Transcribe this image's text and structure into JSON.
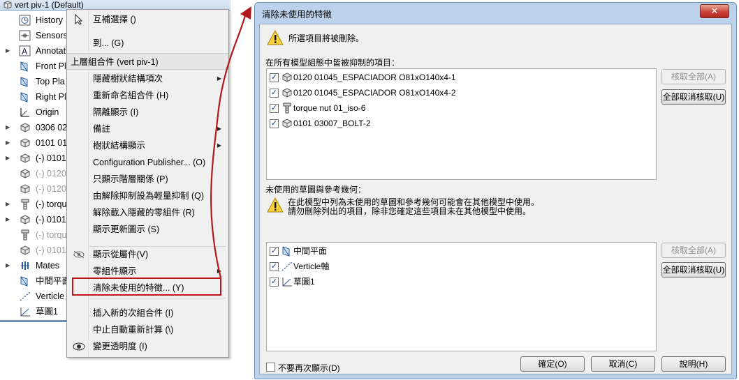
{
  "tree": {
    "title": "vert piv-1  (Default)",
    "items": [
      {
        "label": "History",
        "icon": "history-icon",
        "expand": ""
      },
      {
        "label": "Sensors",
        "icon": "sensor-icon",
        "expand": ""
      },
      {
        "label": "Annotat",
        "icon": "annotation-icon",
        "expand": "▶"
      },
      {
        "label": "Front Pl",
        "icon": "plane-icon",
        "expand": ""
      },
      {
        "label": "Top Pla",
        "icon": "plane-icon",
        "expand": ""
      },
      {
        "label": "Right Pl",
        "icon": "plane-icon",
        "expand": ""
      },
      {
        "label": "Origin",
        "icon": "origin-icon",
        "expand": ""
      },
      {
        "label": "0306 02",
        "icon": "part-icon",
        "expand": "▶"
      },
      {
        "label": "0101 01",
        "icon": "part-icon",
        "expand": "▶"
      },
      {
        "label": "(-) 0101",
        "icon": "part-icon",
        "expand": "▶"
      },
      {
        "label": "(-) 0120",
        "icon": "part-icon",
        "expand": "",
        "dim": true
      },
      {
        "label": "(-) 0120",
        "icon": "part-icon",
        "expand": "",
        "dim": true
      },
      {
        "label": "(-) torqu",
        "icon": "bolt-icon",
        "expand": "▶"
      },
      {
        "label": "(-) 0101",
        "icon": "part-icon",
        "expand": "▶"
      },
      {
        "label": "(-) torqu",
        "icon": "bolt-icon",
        "expand": "",
        "dim": true
      },
      {
        "label": "(-) 0101",
        "icon": "part-icon",
        "expand": "",
        "dim": true
      },
      {
        "label": "Mates",
        "icon": "mates-icon",
        "expand": "▶"
      },
      {
        "label": "中間平面",
        "icon": "plane-icon",
        "expand": ""
      },
      {
        "label": "Verticle",
        "icon": "axis-icon",
        "expand": ""
      },
      {
        "label": "草圖1",
        "icon": "sketch-icon",
        "expand": ""
      }
    ]
  },
  "menu": {
    "top_items": [
      {
        "label": "互補選擇 ()",
        "icon": "select-cursor-icon",
        "arrow": ""
      },
      {
        "label": "到... (G)",
        "icon": "",
        "arrow": ""
      }
    ],
    "header": "上層組合件 (vert piv-1)",
    "items": [
      {
        "label": "隱藏樹狀結構項次",
        "arrow": "▶",
        "icon": ""
      },
      {
        "label": "重新命名組合件 (H)",
        "arrow": "",
        "icon": ""
      },
      {
        "label": "隔離顯示 (I)",
        "arrow": "",
        "icon": ""
      },
      {
        "label": "備註",
        "arrow": "▶",
        "icon": ""
      },
      {
        "label": "樹狀結構顯示",
        "arrow": "▶",
        "icon": ""
      },
      {
        "label": "Configuration Publisher... (O)",
        "arrow": "",
        "icon": ""
      },
      {
        "label": "只顯示階層關係 (P)",
        "arrow": "",
        "icon": ""
      },
      {
        "label": "由解除抑制設為輕量抑制 (Q)",
        "arrow": "",
        "icon": ""
      },
      {
        "label": "解除載入隱藏的零組件 (R)",
        "arrow": "",
        "icon": ""
      },
      {
        "label": "顯示更新圖示 (S)",
        "arrow": "",
        "icon": ""
      },
      {
        "label": "顯示從屬件(V)",
        "arrow": "",
        "icon": "eye-off-icon"
      },
      {
        "label": "零組件顯示",
        "arrow": "▶",
        "icon": ""
      },
      {
        "label": "清除未使用的特徵... (Y)",
        "arrow": "",
        "icon": ""
      },
      {
        "label": "插入新的次組合件 (I)",
        "arrow": "",
        "icon": ""
      },
      {
        "label": "中止自動重新計算 (\\)",
        "arrow": "",
        "icon": ""
      },
      {
        "label": "變更透明度 (I)",
        "arrow": "",
        "icon": "transparency-icon"
      }
    ]
  },
  "dialog": {
    "title": "清除未使用的特徵",
    "close_label": "✕",
    "warning1": "所選項目將被刪除。",
    "section1_label": "在所有模型組態中皆被抑制的項目：",
    "suppressed_items": [
      {
        "label": "0120 01045_ESPACIADOR O81xO140x4-1",
        "icon": "part-icon",
        "checked": "✓"
      },
      {
        "label": "0120 01045_ESPACIADOR O81xO140x4-2",
        "icon": "part-icon",
        "checked": "✓"
      },
      {
        "label": "torque nut 01_iso-6",
        "icon": "bolt-icon",
        "checked": "✓"
      },
      {
        "label": "0101 03007_BOLT-2",
        "icon": "part-icon",
        "checked": "✓"
      }
    ],
    "section2_label": "未使用的草圖與參考幾何：",
    "warning2_line1": "在此模型中列為未使用的草圖和參考幾何可能會在其他模型中使用。",
    "warning2_line2": "請勿刪除列出的項目，除非您確定這些項目未在其他模型中使用。",
    "unused_items": [
      {
        "label": "中間平面",
        "icon": "plane-icon",
        "checked": "✓"
      },
      {
        "label": "Verticle軸",
        "icon": "axis-icon",
        "checked": "✓"
      },
      {
        "label": "草圖1",
        "icon": "sketch-icon",
        "checked": "✓"
      }
    ],
    "check_all_label": "核取全部(A)",
    "uncheck_all_label": "全部取消核取(U)",
    "dont_show_label": "不要再次顯示(D)",
    "ok_label": "確定(O)",
    "cancel_label": "取消(C)",
    "help_label": "說明(H)"
  },
  "colors": {
    "highlight_border": "#c0141b",
    "arrow": "#b01a1d"
  }
}
